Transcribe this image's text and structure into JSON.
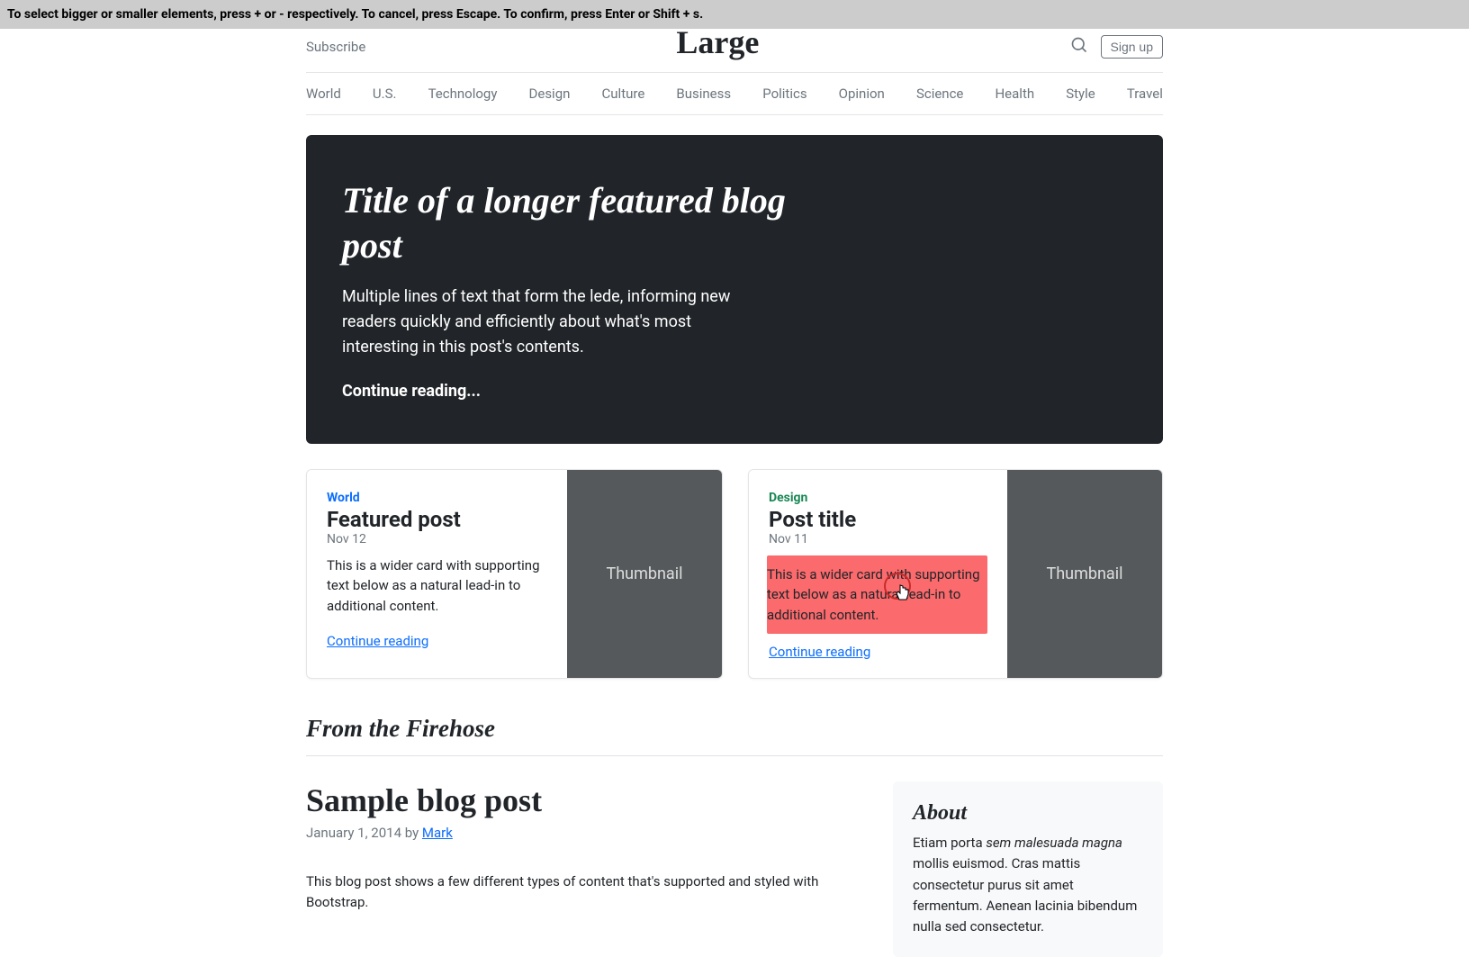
{
  "hint": "To select bigger or smaller elements, press + or - respectively. To cancel, press Escape. To confirm, press Enter or Shift + s.",
  "topbar": {
    "subscribe": "Subscribe",
    "brand": "Large",
    "signup": "Sign up"
  },
  "nav": [
    "World",
    "U.S.",
    "Technology",
    "Design",
    "Culture",
    "Business",
    "Politics",
    "Opinion",
    "Science",
    "Health",
    "Style",
    "Travel"
  ],
  "jumbo": {
    "title": "Title of a longer featured blog post",
    "lede": "Multiple lines of text that form the lede, informing new readers quickly and efficiently about what's most interesting in this post's contents.",
    "continue": "Continue reading..."
  },
  "cards": [
    {
      "category": "World",
      "title": "Featured post",
      "date": "Nov 12",
      "text": "This is a wider card with supporting text below as a natural lead-in to additional content.",
      "link": "Continue reading",
      "thumb": "Thumbnail"
    },
    {
      "category": "Design",
      "title": "Post title",
      "date": "Nov 11",
      "text": "This is a wider card with supporting text below as a natural lead-in to additional content.",
      "link": "Continue reading",
      "thumb": "Thumbnail"
    }
  ],
  "firehose": "From the Firehose",
  "post": {
    "title": "Sample blog post",
    "meta_date": "January 1, 2014",
    "meta_by": " by ",
    "meta_author": "Mark",
    "body": "This blog post shows a few different types of content that's supported and styled with Bootstrap."
  },
  "about": {
    "heading": "About",
    "pre": "Etiam porta ",
    "em": "sem malesuada magna",
    "post": " mollis euismod. Cras mattis consectetur purus sit amet fermentum. Aenean lacinia bibendum nulla sed consectetur."
  }
}
